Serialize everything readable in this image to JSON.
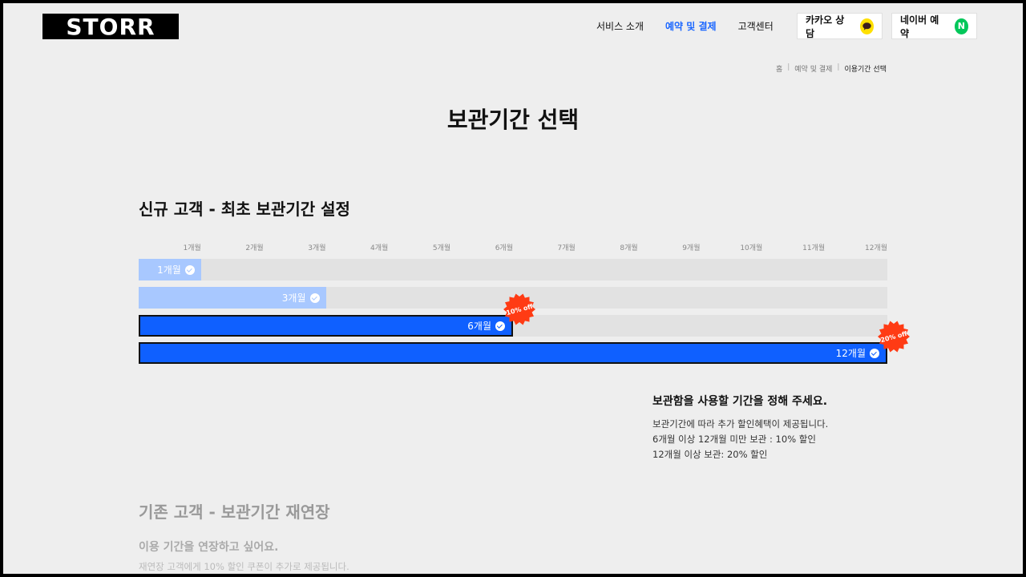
{
  "header": {
    "logo": "STORR",
    "nav": [
      "서비스 소개",
      "예약 및 결제",
      "고객센터"
    ],
    "active_nav": 1,
    "kakao": {
      "label": "카카오 상담",
      "icon": "kakao-chat-icon",
      "color": "#ffe000"
    },
    "naver": {
      "label": "네이버 예약",
      "icon_text": "N",
      "color": "#03c75a"
    }
  },
  "breadcrumb": [
    "홈",
    "예약 및 결제",
    "이용기간 선택"
  ],
  "page_title": "보관기간 선택",
  "new_customer": {
    "title": "신규 고객 - 최초 보관기간 설정",
    "months": [
      "1개월",
      "2개월",
      "3개월",
      "4개월",
      "5개월",
      "6개월",
      "7개월",
      "8개월",
      "9개월",
      "10개월",
      "11개월",
      "12개월"
    ],
    "options": [
      {
        "label": "1개월",
        "months": 1,
        "style": "light",
        "badge": ""
      },
      {
        "label": "3개월",
        "months": 3,
        "style": "light",
        "badge": ""
      },
      {
        "label": "6개월",
        "months": 6,
        "style": "dark",
        "badge": "10% off"
      },
      {
        "label": "12개월",
        "months": 12,
        "style": "dark",
        "badge": "20% off"
      }
    ],
    "info_title": "보관함을 사용할 기간을 정해 주세요.",
    "info_lines": [
      "보관기간에 따라 추가 할인혜택이 제공됩니다.",
      "6개월 이상 12개월 미만 보관 : 10% 할인",
      "12개월 이상 보관: 20% 할인"
    ]
  },
  "existing_customer": {
    "title": "기존 고객 - 보관기간 재연장",
    "subtitle": "이용 기간을 연장하고 싶어요.",
    "desc": "재연장 고객에게 10% 할인 쿠폰이 추가로 제공됩니다."
  },
  "colors": {
    "accent": "#0f60ff",
    "light_bar": "#a8c8ff",
    "badge": "#ff3b14",
    "track": "#e2e2e2"
  }
}
